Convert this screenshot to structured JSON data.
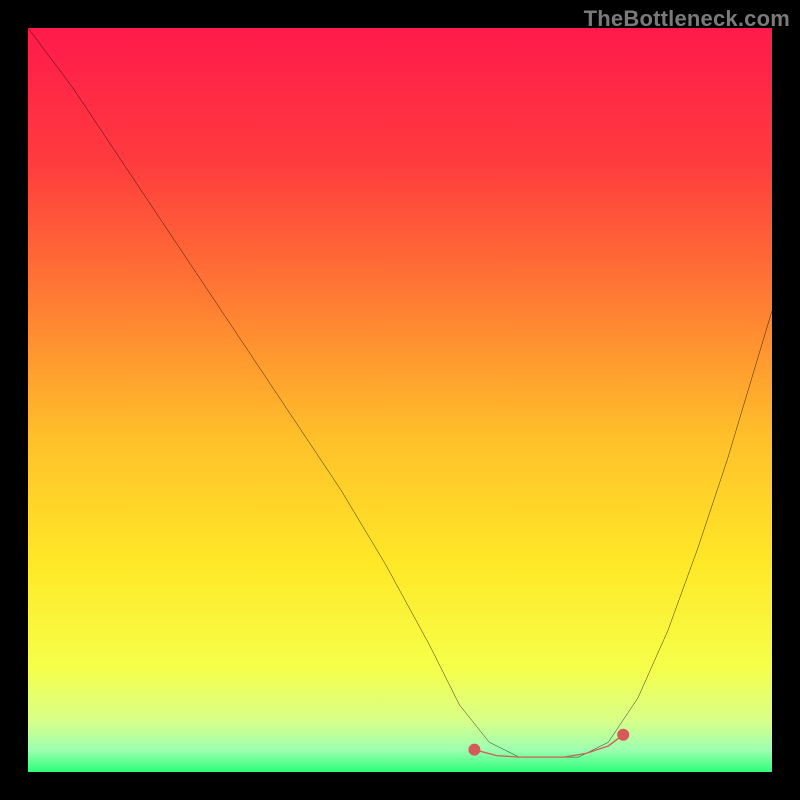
{
  "watermark": "TheBottleneck.com",
  "chart_data": {
    "type": "line",
    "title": "",
    "xlabel": "",
    "ylabel": "",
    "xlim": [
      0,
      100
    ],
    "ylim": [
      0,
      100
    ],
    "grid": false,
    "legend": false,
    "background_gradient": {
      "stops": [
        {
          "pos": 0.0,
          "color": "#ff1a4b"
        },
        {
          "pos": 0.18,
          "color": "#ff3b3e"
        },
        {
          "pos": 0.36,
          "color": "#ff7a33"
        },
        {
          "pos": 0.55,
          "color": "#ffc02a"
        },
        {
          "pos": 0.72,
          "color": "#ffe827"
        },
        {
          "pos": 0.86,
          "color": "#f6ff4a"
        },
        {
          "pos": 0.93,
          "color": "#d9ff88"
        },
        {
          "pos": 0.97,
          "color": "#9dffb0"
        },
        {
          "pos": 1.0,
          "color": "#2dff7a"
        }
      ]
    },
    "series": [
      {
        "name": "bottleneck-curve",
        "color": "#000000",
        "stroke_width": 3,
        "x": [
          0.0,
          6.0,
          12.0,
          18.0,
          24.0,
          30.0,
          36.0,
          42.0,
          48.0,
          54.0,
          58.0,
          62.0,
          66.0,
          70.0,
          74.0,
          78.0,
          82.0,
          86.0,
          90.0,
          94.0,
          100.0
        ],
        "y": [
          100.0,
          92.0,
          83.0,
          74.0,
          65.0,
          56.0,
          47.0,
          38.0,
          28.0,
          17.0,
          9.0,
          4.0,
          2.0,
          2.0,
          2.0,
          4.0,
          10.0,
          19.0,
          30.0,
          42.0,
          62.0
        ]
      }
    ],
    "markers": [
      {
        "name": "range-left",
        "x": 60.0,
        "y": 3.0,
        "color": "#d65a5a",
        "r": 6
      },
      {
        "name": "range-right",
        "x": 80.0,
        "y": 5.0,
        "color": "#d65a5a",
        "r": 6
      }
    ],
    "highlight_segment": {
      "name": "optimal-range",
      "color": "#d65a5a",
      "stroke_width": 10,
      "x": [
        60.0,
        63.0,
        66.0,
        69.0,
        72.0,
        75.0,
        78.0,
        80.0
      ],
      "y": [
        3.0,
        2.2,
        2.0,
        2.0,
        2.0,
        2.5,
        3.5,
        5.0
      ]
    }
  }
}
